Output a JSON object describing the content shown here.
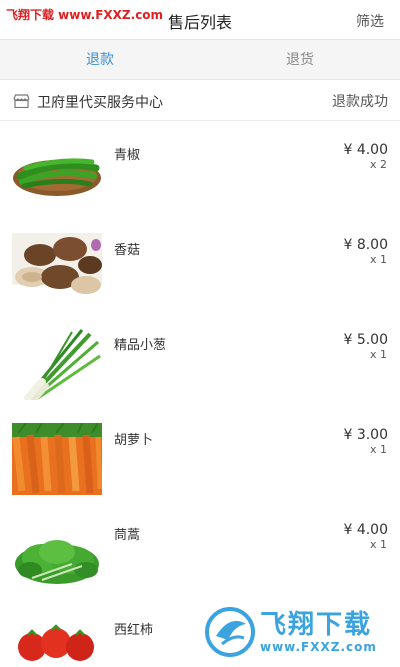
{
  "watermark": {
    "top_left": "飞翔下载 www.FXXZ.com",
    "bottom_right_title": "飞翔下载",
    "bottom_right_url": "www.FXXZ.com"
  },
  "header": {
    "title": "售后列表",
    "filter_label": "筛选"
  },
  "tabs": [
    {
      "label": "退款",
      "active": true
    },
    {
      "label": "退货",
      "active": false
    }
  ],
  "store": {
    "icon": "store-icon",
    "name": "卫府里代买服务中心",
    "status": "退款成功"
  },
  "items": [
    {
      "name": "青椒",
      "price": "¥ 4.00",
      "qty": "x 2",
      "image": "green-pepper-image"
    },
    {
      "name": "香菇",
      "price": "¥ 8.00",
      "qty": "x 1",
      "image": "shiitake-mushroom-image"
    },
    {
      "name": "精品小葱",
      "price": "¥ 5.00",
      "qty": "x 1",
      "image": "scallion-image"
    },
    {
      "name": "胡萝卜",
      "price": "¥ 3.00",
      "qty": "x 1",
      "image": "carrot-image"
    },
    {
      "name": "茼蒿",
      "price": "¥ 4.00",
      "qty": "x 1",
      "image": "crown-daisy-image"
    },
    {
      "name": "西红柿",
      "price": "",
      "qty": "",
      "image": "tomato-image"
    }
  ],
  "colors": {
    "accent": "#3b8fd6",
    "watermark_red": "#e02020",
    "watermark_blue": "#3aa3e0"
  }
}
